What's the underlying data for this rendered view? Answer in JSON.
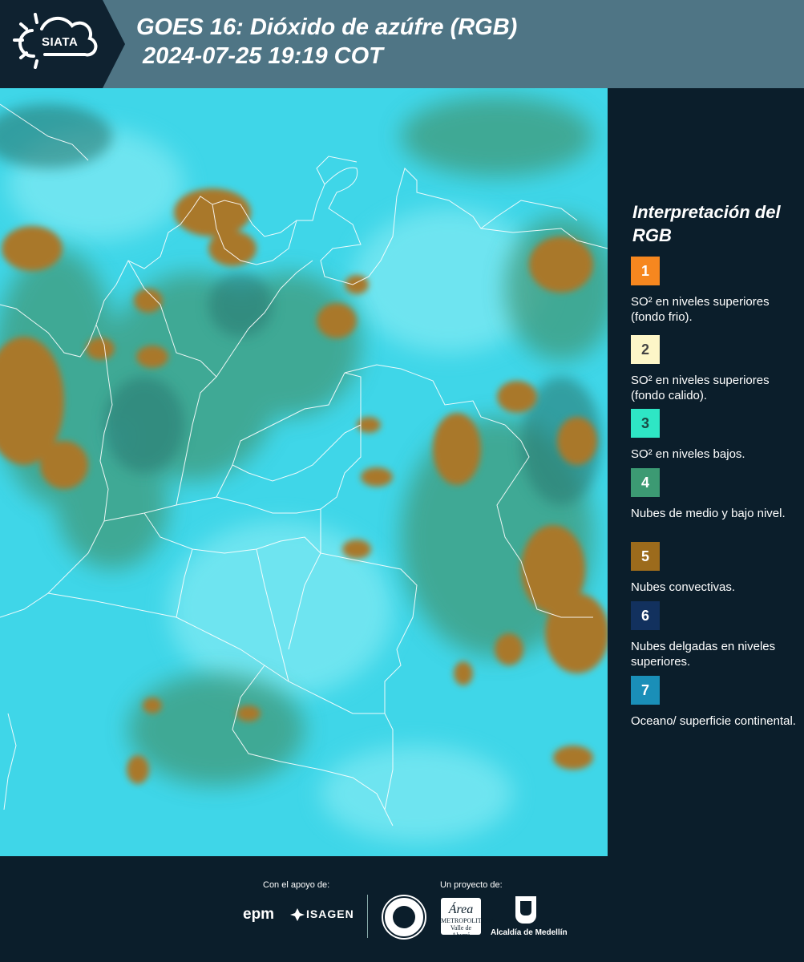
{
  "header": {
    "logo_text": "SIATA",
    "title_line1": "GOES 16: Dióxido de azúfre (RGB)",
    "title_line2": "2024-07-25 19:19 COT"
  },
  "legend": {
    "title": "Interpretación del RGB",
    "items": [
      {
        "num": "1",
        "color": "#f6871f",
        "num_color": "#ffffff",
        "text": "SO² en niveles superiores (fondo frio)."
      },
      {
        "num": "2",
        "color": "#fdf6c8",
        "num_color": "#444444",
        "text": "SO² en niveles superiores (fondo calido)."
      },
      {
        "num": "3",
        "color": "#2ee6c5",
        "num_color": "#1a4a44",
        "text": "SO² en niveles bajos."
      },
      {
        "num": "4",
        "color": "#3c9a73",
        "num_color": "#ffffff",
        "text": "Nubes de medio y bajo nivel."
      },
      {
        "num": "5",
        "color": "#9c6b1c",
        "num_color": "#ffffff",
        "text": "Nubes convectivas."
      },
      {
        "num": "6",
        "color": "#12315e",
        "num_color": "#ffffff",
        "text": "Nubes delgadas en niveles superiores."
      },
      {
        "num": "7",
        "color": "#1a8fb8",
        "num_color": "#ffffff",
        "text": "Oceano/ superficie continental."
      }
    ]
  },
  "footer": {
    "support_caption": "Con el apoyo de:",
    "project_caption": "Un proyecto de:",
    "sponsor_1": "epm",
    "sponsor_2": "ISAGEN",
    "partner_amva_top": "Área",
    "partner_amva_bottom": "METROPOLITANA Valle de Aburrá",
    "partner_alcaldia": "Alcaldía de Medellín"
  }
}
